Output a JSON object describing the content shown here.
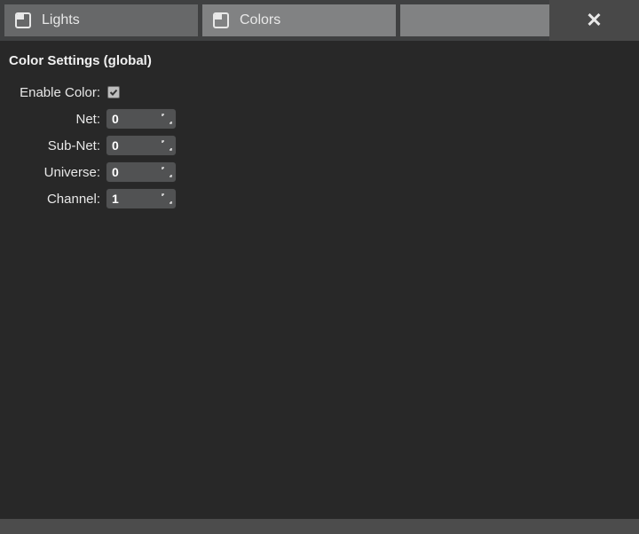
{
  "tabs": {
    "lights": {
      "label": "Lights"
    },
    "colors": {
      "label": "Colors"
    }
  },
  "section": {
    "title": "Color Settings (global)"
  },
  "fields": {
    "enable_color": {
      "label": "Enable Color:",
      "checked": true
    },
    "net": {
      "label": "Net:",
      "value": "0"
    },
    "subnet": {
      "label": "Sub-Net:",
      "value": "0"
    },
    "universe": {
      "label": "Universe:",
      "value": "0"
    },
    "channel": {
      "label": "Channel:",
      "value": "1"
    }
  }
}
